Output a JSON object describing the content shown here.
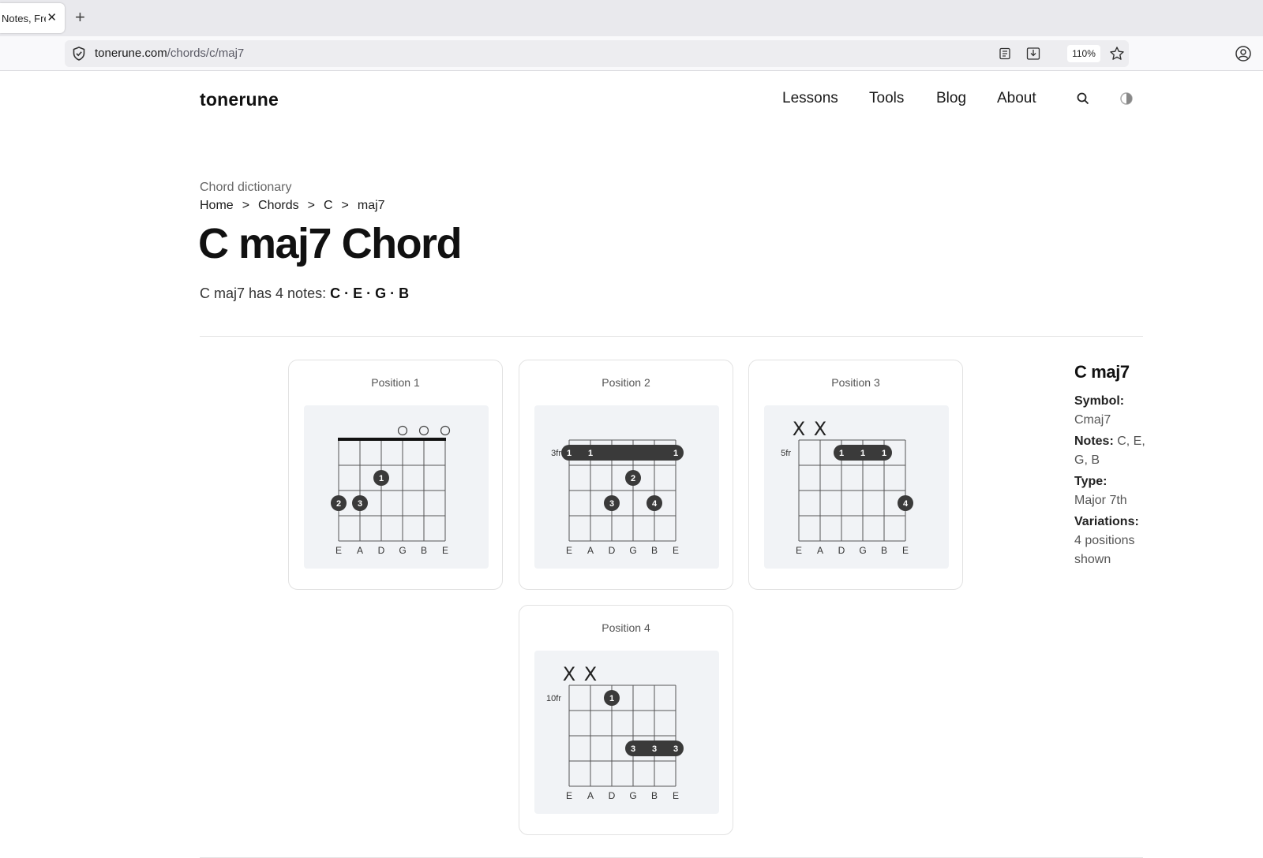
{
  "browser": {
    "tab_title": "Notes, Fre",
    "tab_close": "✕",
    "new_tab": "+",
    "url_domain": "tonerune.com",
    "url_path": "/chords/c/maj7",
    "zoom": "110%"
  },
  "site": {
    "logo": "tonerune",
    "nav": [
      "Lessons",
      "Tools",
      "Blog",
      "About"
    ]
  },
  "page": {
    "eyebrow": "Chord dictionary",
    "breadcrumb": [
      "Home",
      "Chords",
      "C",
      "maj7"
    ],
    "breadcrumb_sep": ">",
    "title": "C maj7 Chord",
    "notes_intro": "C maj7 has 4 notes:",
    "notes_list": "C · E · G · B"
  },
  "positions": [
    {
      "label": "Position 1",
      "fret_label": "",
      "muted": [],
      "open": [
        3,
        4,
        5
      ],
      "nut": true,
      "barre": null,
      "dots": [
        {
          "string": 2,
          "fret": 2,
          "finger": "1"
        },
        {
          "string": 0,
          "fret": 3,
          "finger": "2"
        },
        {
          "string": 1,
          "fret": 3,
          "finger": "3"
        }
      ],
      "strings": [
        "E",
        "A",
        "D",
        "G",
        "B",
        "E"
      ]
    },
    {
      "label": "Position 2",
      "fret_label": "3fr",
      "muted": [],
      "open": [],
      "nut": false,
      "barre": {
        "fret": 1,
        "from": 0,
        "to": 5,
        "fingers": [
          "1",
          "1",
          "1"
        ],
        "finger_strings": [
          0,
          1,
          5
        ],
        "faded": false
      },
      "dots": [
        {
          "string": 3,
          "fret": 2,
          "finger": "2"
        },
        {
          "string": 2,
          "fret": 3,
          "finger": "3"
        },
        {
          "string": 4,
          "fret": 3,
          "finger": "4"
        }
      ],
      "strings": [
        "E",
        "A",
        "D",
        "G",
        "B",
        "E"
      ]
    },
    {
      "label": "Position 3",
      "fret_label": "5fr",
      "muted": [
        0,
        1
      ],
      "muted_symbol": "X",
      "open": [],
      "nut": false,
      "barre": {
        "fret": 1,
        "from": 2,
        "to": 4,
        "fingers": [
          "1",
          "1",
          "1"
        ],
        "finger_strings": [
          2,
          3,
          4
        ],
        "faded": true
      },
      "dots": [
        {
          "string": 5,
          "fret": 3,
          "finger": "4"
        }
      ],
      "strings": [
        "E",
        "A",
        "D",
        "G",
        "B",
        "E"
      ]
    },
    {
      "label": "Position 4",
      "fret_label": "10fr",
      "muted": [
        0,
        1
      ],
      "muted_symbol": "X",
      "open": [],
      "nut": false,
      "barre": {
        "fret": 3,
        "from": 3,
        "to": 5,
        "fingers": [
          "3",
          "3",
          "3"
        ],
        "finger_strings": [
          3,
          4,
          5
        ],
        "faded": false
      },
      "dots": [
        {
          "string": 2,
          "fret": 1,
          "finger": "1"
        }
      ],
      "strings": [
        "E",
        "A",
        "D",
        "G",
        "B",
        "E"
      ]
    }
  ],
  "sidebar": {
    "title": "C maj7",
    "symbol_label": "Symbol:",
    "symbol_value": "Cmaj7",
    "notes_label": "Notes:",
    "notes_value": "C, E, G, B",
    "type_label": "Type:",
    "type_value": "Major 7th",
    "variations_label": "Variations:",
    "variations_value": "4 positions shown"
  },
  "colors": {
    "dot": "#3a3a3a",
    "diagram_bg": "#f1f3f6",
    "grid": "#555555"
  }
}
